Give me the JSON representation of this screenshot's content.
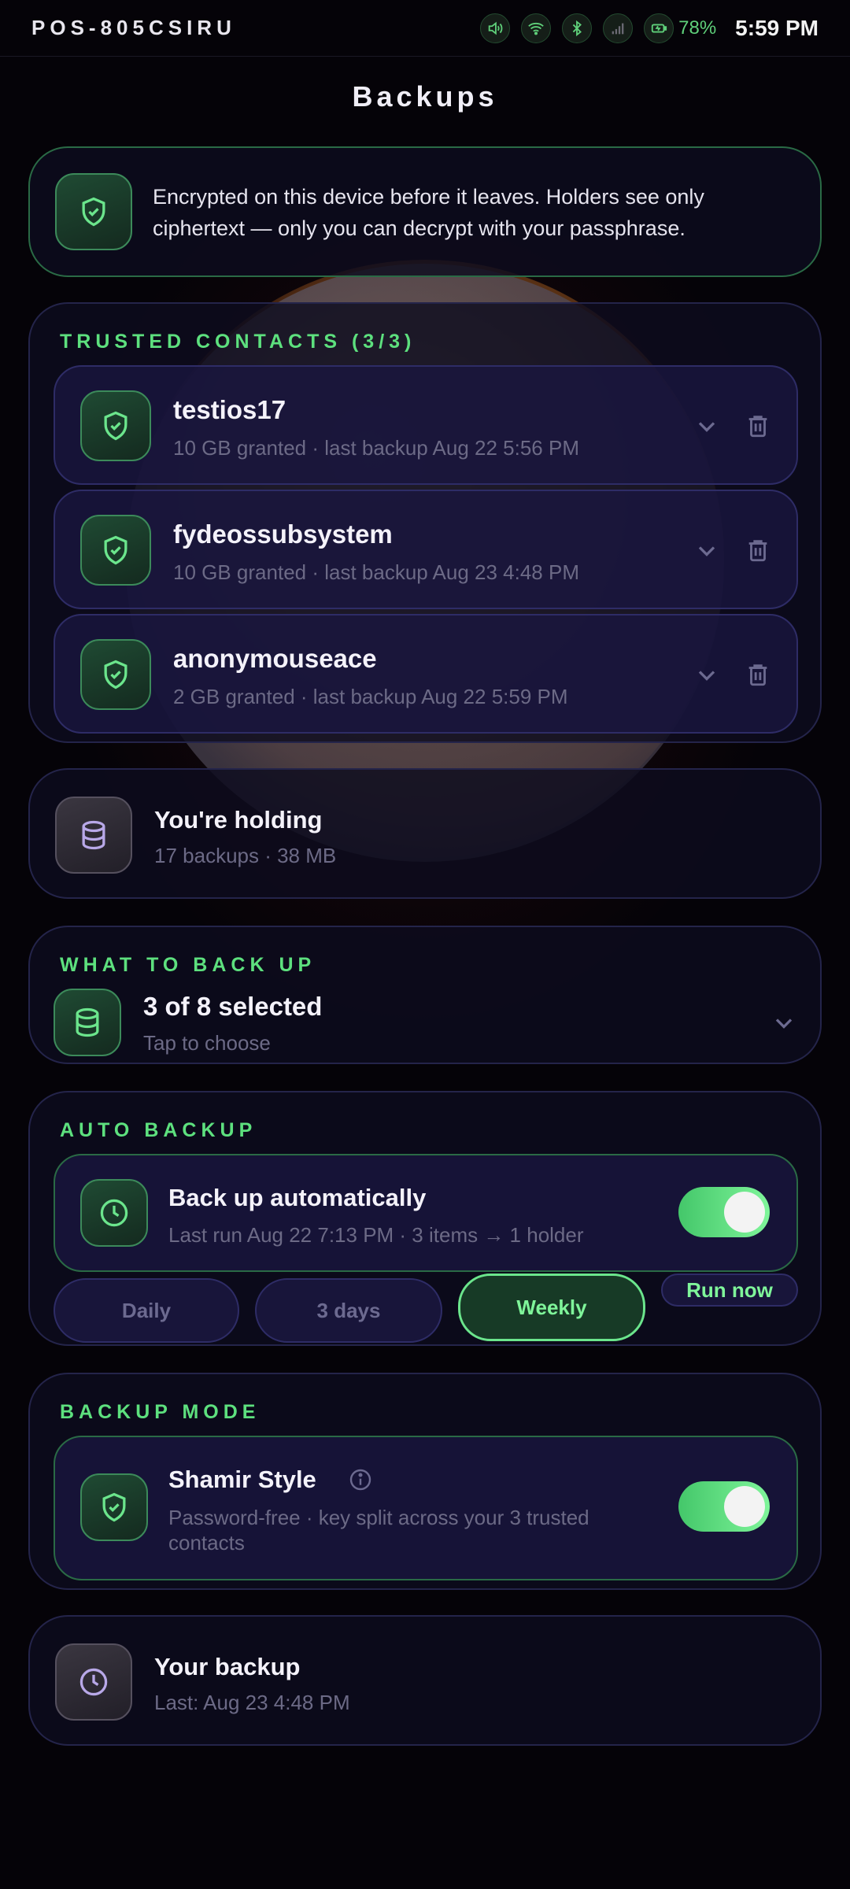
{
  "status_bar": {
    "device_name": "POS-805CSIRU",
    "battery": "78%",
    "time": "5:59 PM",
    "icons": [
      "volume-icon",
      "wifi-icon",
      "bluetooth-icon",
      "signal-icon",
      "battery-icon"
    ]
  },
  "page": {
    "title": "Backups"
  },
  "encryption_notice": {
    "text": "Encrypted on this device before it leaves. Holders see only ciphertext — only you can decrypt with your passphrase.",
    "icon": "shield-check-icon"
  },
  "trusted_contacts": {
    "label": "TRUSTED CONTACTS (3/3)",
    "items": [
      {
        "name": "testios17",
        "detail": "10 GB granted · last backup Aug 22 5:56 PM"
      },
      {
        "name": "fydeossubsystem",
        "detail": "10 GB granted · last backup Aug 23 4:48 PM"
      },
      {
        "name": "anonymouseace",
        "detail": "2 GB granted · last backup Aug 22 5:59 PM"
      }
    ]
  },
  "holding": {
    "title": "You're holding",
    "detail": "17 backups · 38 MB",
    "icon": "database-icon"
  },
  "what_to_back_up": {
    "label": "WHAT TO BACK UP",
    "title": "3 of 8 selected",
    "detail": "Tap to choose",
    "icon": "database-icon"
  },
  "auto_backup": {
    "label": "AUTO BACKUP",
    "title": "Back up automatically",
    "detail": "Last run Aug 22 7:13 PM · 3 items → 1 holder",
    "enabled": true,
    "frequencies": [
      "Daily",
      "3 days",
      "Weekly"
    ],
    "selected": "Weekly",
    "run_now": "Run now",
    "icon": "clock-icon"
  },
  "backup_mode": {
    "label": "BACKUP MODE",
    "title": "Shamir Style",
    "detail": "Password-free · key split across your 3 trusted contacts",
    "enabled": true,
    "icon": "shield-check-icon"
  },
  "your_backup": {
    "title": "Your backup",
    "detail": "Last: Aug 23 4:48 PM",
    "icon": "clock-icon"
  },
  "colors": {
    "accent_green": "#5de07e",
    "card_bg": "#0e0c1e",
    "muted_text": "#6c6a86"
  }
}
